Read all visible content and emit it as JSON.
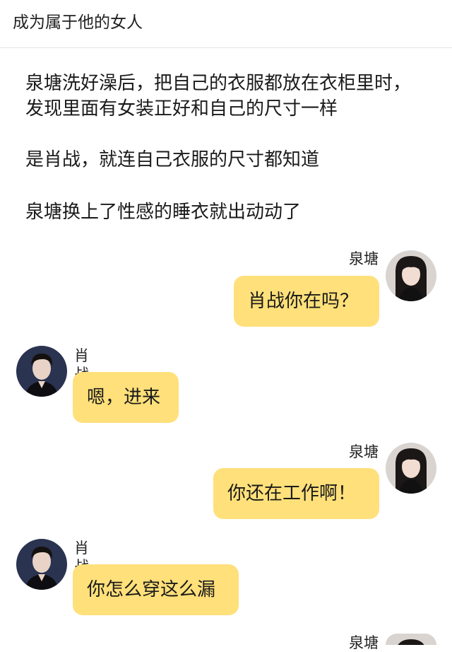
{
  "header": {
    "title": "成为属于他的女人"
  },
  "narration": [
    "泉塘洗好澡后，把自己的衣服都放在衣柜里时，发现里面有女装正好和自己的尺寸一样",
    "是肖战，就连自己衣服的尺寸都知道",
    "泉塘换上了性感的睡衣就出动动了"
  ],
  "messages": [
    {
      "side": "right",
      "sender": "泉塘",
      "text": "肖战你在吗？"
    },
    {
      "side": "left",
      "sender": "肖战",
      "text": "嗯，进来"
    },
    {
      "side": "right",
      "sender": "泉塘",
      "text": "你还在工作啊！"
    },
    {
      "side": "left",
      "sender": "肖战",
      "text": "你怎么穿这么漏"
    },
    {
      "side": "right",
      "sender": "泉塘",
      "text": ""
    }
  ],
  "colors": {
    "bubble": "#ffe07a",
    "background": "#ffffff"
  }
}
